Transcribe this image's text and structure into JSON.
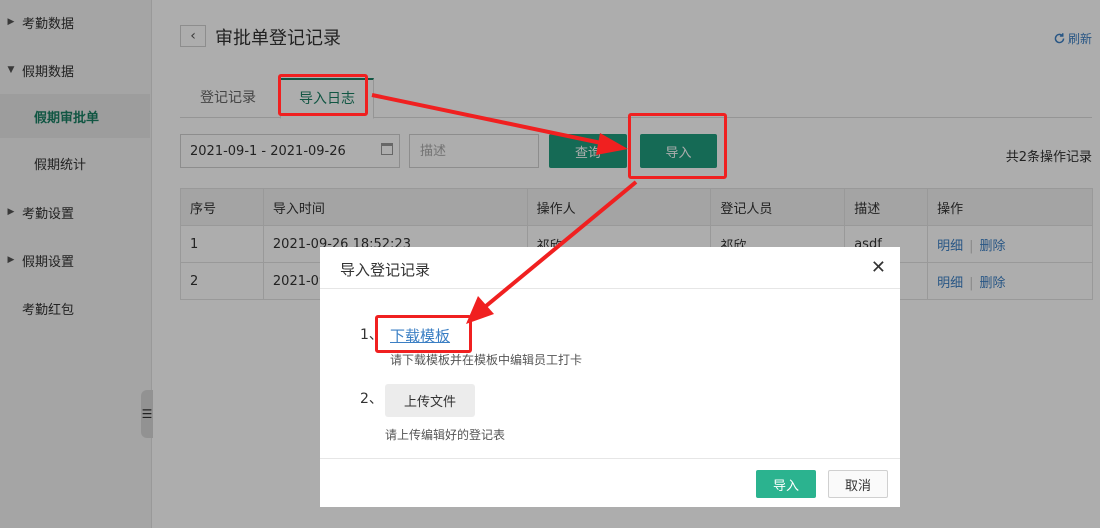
{
  "sidebar": {
    "items": [
      {
        "label": "考勤数据"
      },
      {
        "label": "假期数据"
      },
      {
        "label": "假期审批单"
      },
      {
        "label": "假期统计"
      },
      {
        "label": "考勤设置"
      },
      {
        "label": "假期设置"
      },
      {
        "label": "考勤红包"
      }
    ]
  },
  "header": {
    "back_glyph": "‹",
    "title": "审批单登记记录",
    "refresh_label": "刷新"
  },
  "tabs": [
    {
      "label": "登记记录"
    },
    {
      "label": "导入日志"
    }
  ],
  "filters": {
    "date_range": "2021-09-1 - 2021-09-26",
    "desc_placeholder": "描述",
    "query_label": "查询",
    "import_label": "导入",
    "total_text": "共2条操作记录"
  },
  "table": {
    "headers": [
      "序号",
      "导入时间",
      "操作人",
      "登记人员",
      "描述",
      "操作"
    ],
    "rows": [
      {
        "index": "1",
        "time": "2021-09-26 18:52:23",
        "operator": "祁欣",
        "registrant": "祁欣",
        "desc": "asdf",
        "detail": "明细",
        "delete": "删除"
      },
      {
        "index": "2",
        "time": "2021-09",
        "operator": "",
        "registrant": "",
        "desc": "",
        "detail": "明细",
        "delete": "删除"
      }
    ]
  },
  "modal": {
    "title": "导入登记记录",
    "close_glyph": "✕",
    "step1_num": "1、",
    "step1_link": "下载模板",
    "step1_hint": "请下载模板并在模板中编辑员工打卡",
    "step2_num": "2、",
    "step2_button": "上传文件",
    "step2_hint": "请上传编辑好的登记表",
    "ok_label": "导入",
    "cancel_label": "取消"
  },
  "colors": {
    "accent": "#1f9d7e",
    "link": "#3b7fc4",
    "annotation": "#f02020"
  }
}
